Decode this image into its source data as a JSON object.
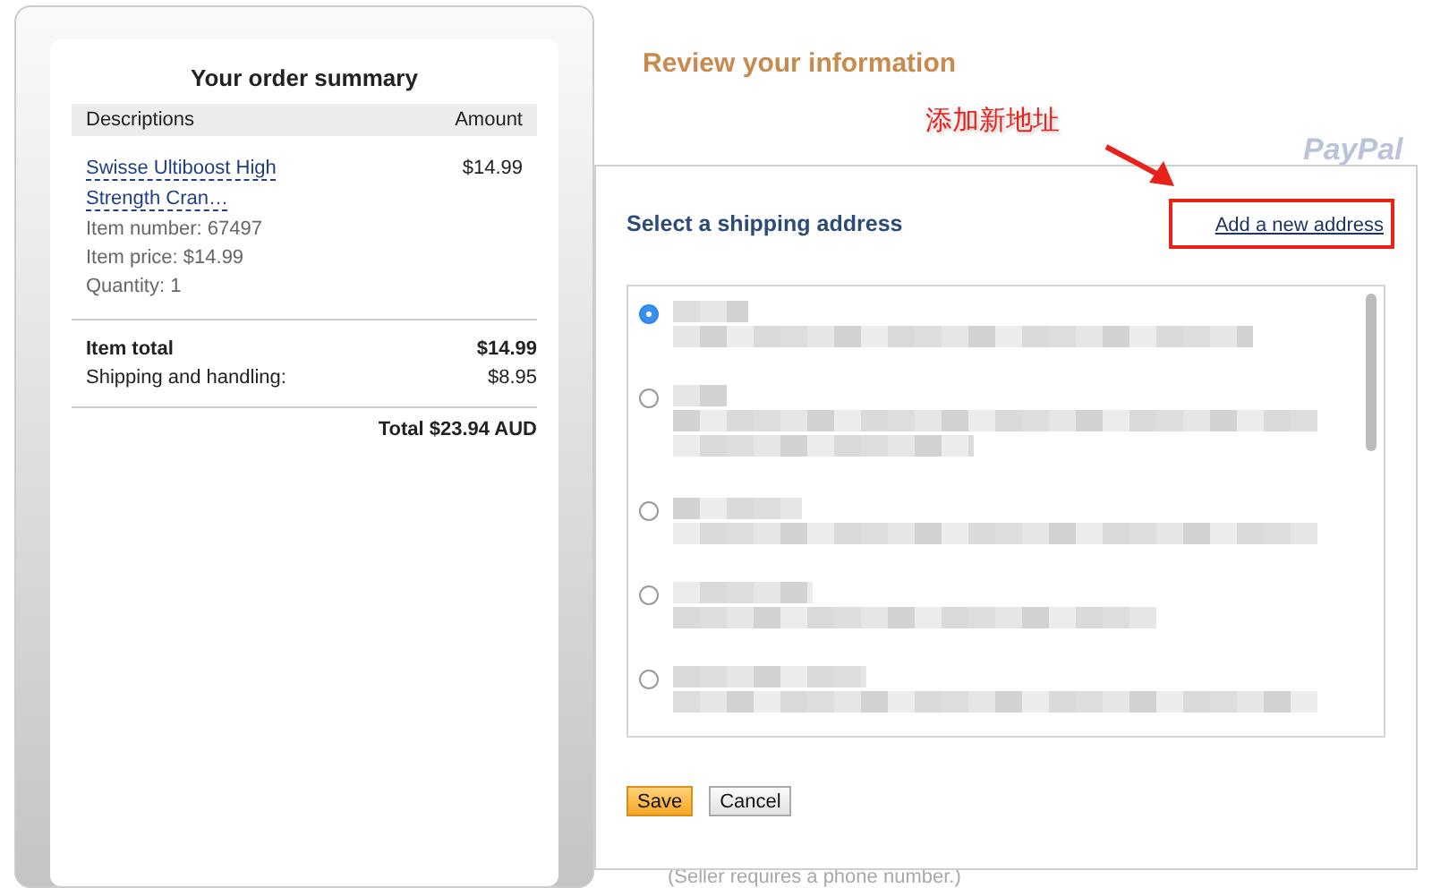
{
  "order_summary": {
    "title": "Your order summary",
    "columns": [
      "Descriptions",
      "Amount"
    ],
    "item": {
      "name": "Swisse Ultiboost High Strength Cran…",
      "amount": "$14.99",
      "details": [
        "Item number: 67497",
        "Item price: $14.99",
        "Quantity: 1"
      ]
    },
    "totals": [
      {
        "label": "Item total",
        "value": "$14.99",
        "kind": "bold"
      },
      {
        "label": "Shipping and handling:",
        "value": "$8.95",
        "kind": "plain"
      }
    ],
    "grand_total": "Total $23.94 AUD"
  },
  "page": {
    "heading": "Review your information",
    "logo": "PayPal",
    "note": "(Seller requires a phone number.)"
  },
  "annotation": {
    "text": "添加新地址"
  },
  "dialog": {
    "title": "Select a shipping address",
    "link": "Add a new address",
    "addresses": [
      {
        "selected": true
      },
      {
        "selected": false
      },
      {
        "selected": false
      },
      {
        "selected": false
      },
      {
        "selected": false
      }
    ],
    "buttons": [
      {
        "label": "Save",
        "kind": "primary"
      },
      {
        "label": "Cancel",
        "kind": "secondary"
      }
    ]
  }
}
